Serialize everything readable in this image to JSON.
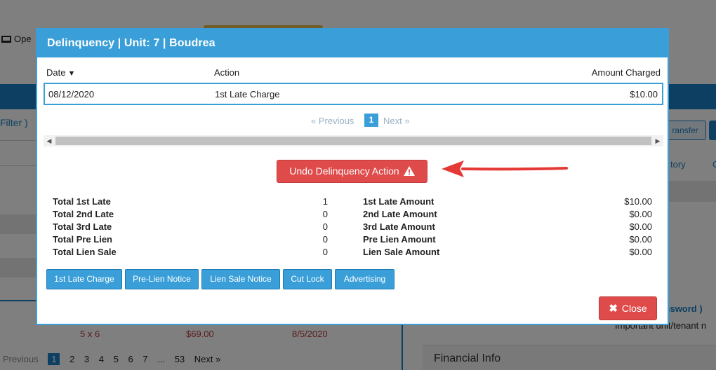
{
  "background": {
    "monitor_label": "Ope",
    "filter_text": "Filter )",
    "transfer_label": "ransfer",
    "history_label": "tory",
    "c_label": "C",
    "row_values": [
      "5 x 6",
      "$69.00",
      "8/5/2020"
    ],
    "pagination": {
      "previous": "Previous",
      "pages": [
        "1",
        "2",
        "3",
        "4",
        "5",
        "6",
        "7",
        "...",
        "53"
      ],
      "next": "Next »"
    },
    "password_link": "assword )",
    "important_text": "Important unit/tenant n",
    "financial_info": "Financial Info"
  },
  "modal": {
    "title": "Delinquency | Unit: 7 | Boudrea",
    "table": {
      "headers": {
        "date": "Date",
        "sort_indicator": "▼",
        "action": "Action",
        "amount": "Amount Charged"
      },
      "rows": [
        {
          "date": "08/12/2020",
          "action": "1st Late Charge",
          "amount": "$10.00"
        }
      ]
    },
    "pager": {
      "previous": "« Previous",
      "current": "1",
      "next": "Next »"
    },
    "undo_button": "Undo Delinquency Action",
    "stats": {
      "counts": [
        {
          "label": "Total 1st Late",
          "value": "1"
        },
        {
          "label": "Total 2nd Late",
          "value": "0"
        },
        {
          "label": "Total 3rd Late",
          "value": "0"
        },
        {
          "label": "Total Pre Lien",
          "value": "0"
        },
        {
          "label": "Total Lien Sale",
          "value": "0"
        }
      ],
      "amounts": [
        {
          "label": "1st Late Amount",
          "value": "$10.00"
        },
        {
          "label": "2nd Late Amount",
          "value": "$0.00"
        },
        {
          "label": "3rd Late Amount",
          "value": "$0.00"
        },
        {
          "label": "Pre Lien Amount",
          "value": "$0.00"
        },
        {
          "label": "Lien Sale Amount",
          "value": "$0.00"
        }
      ]
    },
    "action_buttons": [
      "1st Late Charge",
      "Pre-Lien Notice",
      "Lien Sale Notice",
      "Cut Lock",
      "Advertising"
    ],
    "close_button": "Close"
  },
  "colors": {
    "header_blue": "#3a9fd9",
    "danger_red": "#df4b4b",
    "annotation_arrow": "#e53935"
  },
  "icons": [
    "monitor-icon",
    "sort-desc-icon",
    "warning-icon",
    "close-icon",
    "scroll-left-icon",
    "scroll-right-icon",
    "annotation-arrow"
  ]
}
